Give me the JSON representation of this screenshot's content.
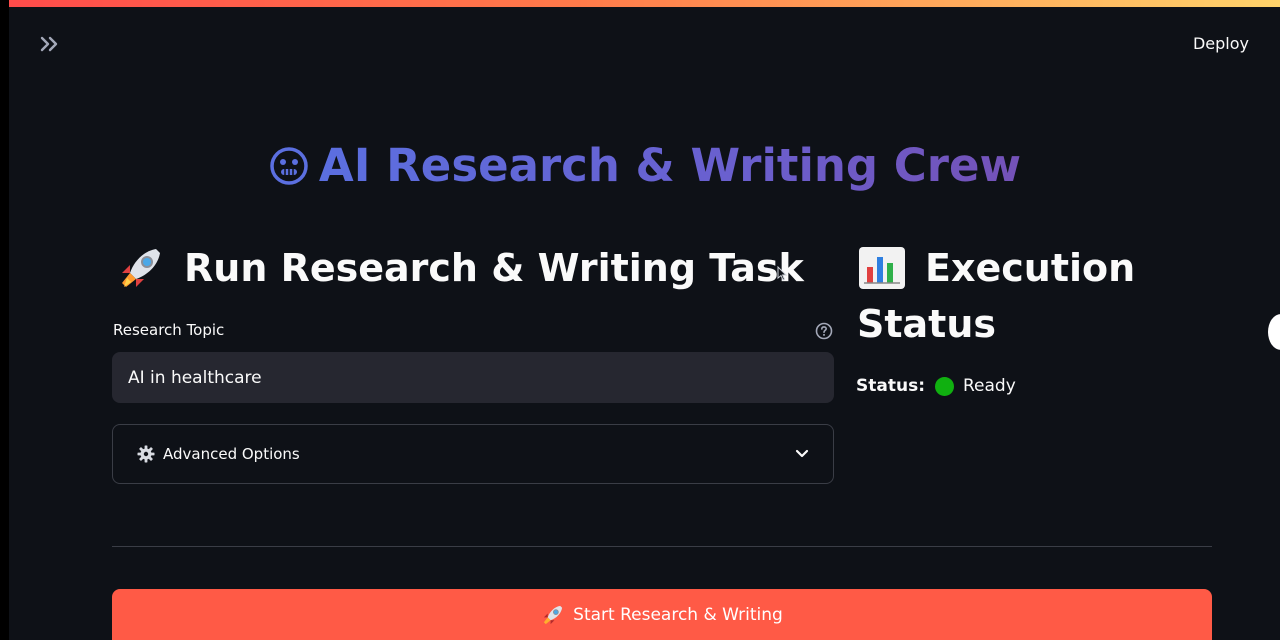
{
  "header": {
    "deploy_label": "Deploy"
  },
  "title": {
    "text": "AI Research & Writing Crew",
    "icon": "robot-face-icon"
  },
  "left_panel": {
    "heading": "Run Research & Writing Task",
    "heading_icon": "rocket-icon",
    "topic_label": "Research Topic",
    "topic_value": "AI in healthcare",
    "advanced_label": "Advanced Options"
  },
  "right_panel": {
    "heading_line1": "Execution",
    "heading_line2": "Status",
    "heading_icon": "bar-chart-icon",
    "status_label": "Status:",
    "status_value": "Ready",
    "status_color": "#10b010"
  },
  "action": {
    "start_label": "Start Research & Writing"
  },
  "colors": {
    "background": "#0e1117",
    "accent": "#ff5a46",
    "title_gradient_start": "#5b6fe0",
    "title_gradient_end": "#7452b8"
  }
}
